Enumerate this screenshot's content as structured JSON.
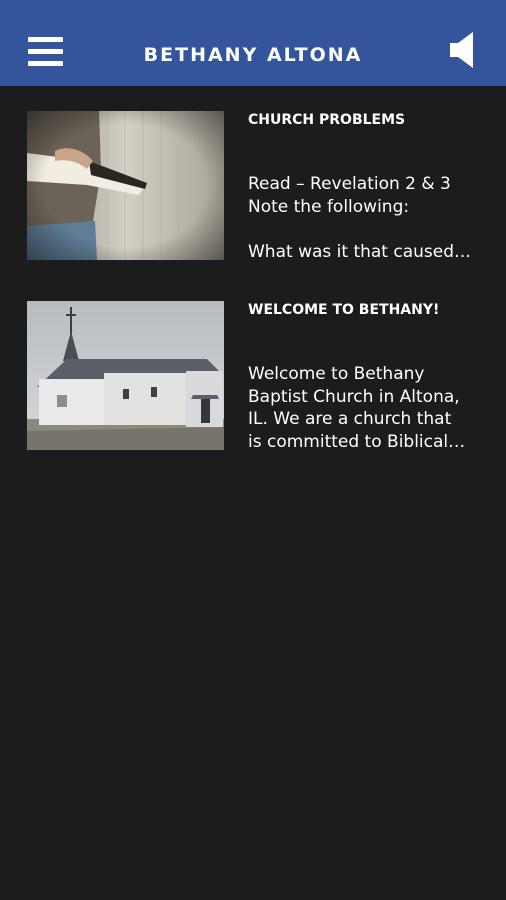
{
  "header": {
    "title": "BETHANY ALTONA",
    "menu_icon": "hamburger-menu-icon",
    "audio_icon": "speaker-icon",
    "background_color": "#34559c"
  },
  "posts": [
    {
      "title": "CHURCH PROBLEMS",
      "excerpt_lines": [
        "Read – Revelation 2 & 3",
        "Note the following:",
        "",
        "What was it that caused…"
      ],
      "thumbnail": "person-holding-bible-image"
    },
    {
      "title": "WELCOME TO BETHANY!",
      "excerpt_lines": [
        "Welcome to Bethany",
        "Baptist Church in Altona,",
        "IL. We are a church that",
        "is committed to Biblical…"
      ],
      "thumbnail": "church-building-image"
    }
  ]
}
